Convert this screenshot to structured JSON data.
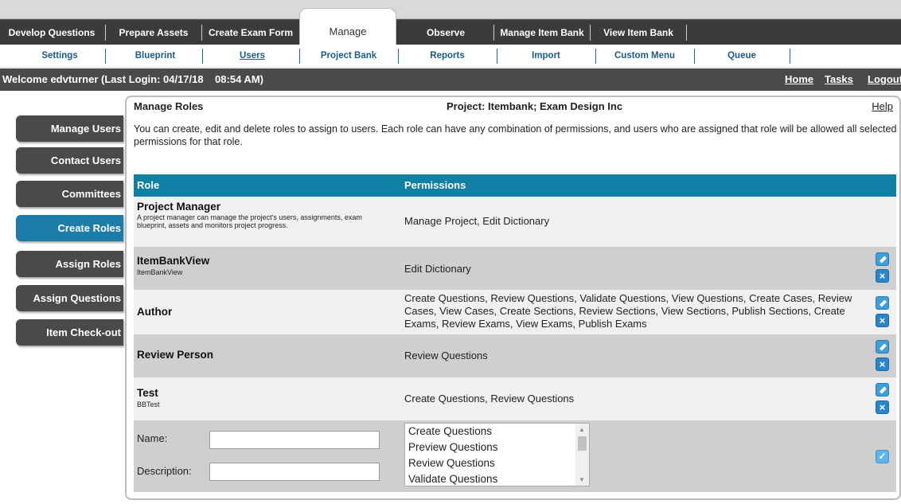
{
  "main_tabs": [
    {
      "label": "Develop Questions"
    },
    {
      "label": "Prepare Assets"
    },
    {
      "label": "Create Exam Form"
    },
    {
      "label": "Manage"
    },
    {
      "label": "Observe"
    },
    {
      "label": "Manage Item Bank"
    },
    {
      "label": "View Item Bank"
    }
  ],
  "sub_tabs": [
    {
      "label": "Settings"
    },
    {
      "label": "Blueprint"
    },
    {
      "label": "Users"
    },
    {
      "label": "Project Bank"
    },
    {
      "label": "Reports"
    },
    {
      "label": "Import"
    },
    {
      "label": "Custom Menu"
    },
    {
      "label": "Queue"
    }
  ],
  "header": {
    "welcome": "Welcome edvturner (Last Login: 04/17/18    08:54 AM)",
    "links": [
      "Home",
      "Tasks",
      "Logout"
    ]
  },
  "sidebar": {
    "items": [
      {
        "label": "Manage Users"
      },
      {
        "label": "Contact Users"
      },
      {
        "label": "Committees"
      },
      {
        "label": "Create Roles",
        "active": true
      },
      {
        "label": "Assign Roles"
      },
      {
        "label": "Assign Questions"
      },
      {
        "label": "Item Check-out"
      }
    ]
  },
  "panel": {
    "title": "Manage Roles",
    "project": "Project: Itembank; Exam Design Inc",
    "help": "Help",
    "description": "You can create, edit and delete roles to assign to users. Each role can have any combination of permissions, and users who are assigned that role will be allowed all selected permissions for that role."
  },
  "table": {
    "headers": {
      "role": "Role",
      "permissions": "Permissions"
    },
    "rows": [
      {
        "name": "Project Manager",
        "description": "A project manager can manage the project's users, assignments, exam blueprint, assets and monitors project progress.",
        "permissions": "Manage Project, Edit Dictionary"
      },
      {
        "name": "ItemBankView",
        "description": "ItemBankView",
        "permissions": "Edit Dictionary"
      },
      {
        "name": "Author",
        "description": "",
        "permissions": "Create Questions, Review Questions, Validate Questions, View Questions, Create Cases, Review Cases, View Cases, Create Sections, Review Sections, View Sections, Publish Sections, Create Exams, Review Exams, View Exams, Publish Exams"
      },
      {
        "name": "Review Person",
        "description": "",
        "permissions": "Review Questions"
      },
      {
        "name": "Test",
        "description": "BBTest",
        "permissions": "Create Questions, Review Questions"
      }
    ]
  },
  "form": {
    "name_label": "Name:",
    "description_label": "Description:",
    "name_value": "",
    "description_value": "",
    "permission_options": [
      "Create Questions",
      "Preview Questions",
      "Review Questions",
      "Validate Questions"
    ]
  },
  "colors": {
    "accent": "#0f7fa3",
    "nav_dark": "#4a4a4a",
    "nav_active": "#1e7ca8"
  }
}
